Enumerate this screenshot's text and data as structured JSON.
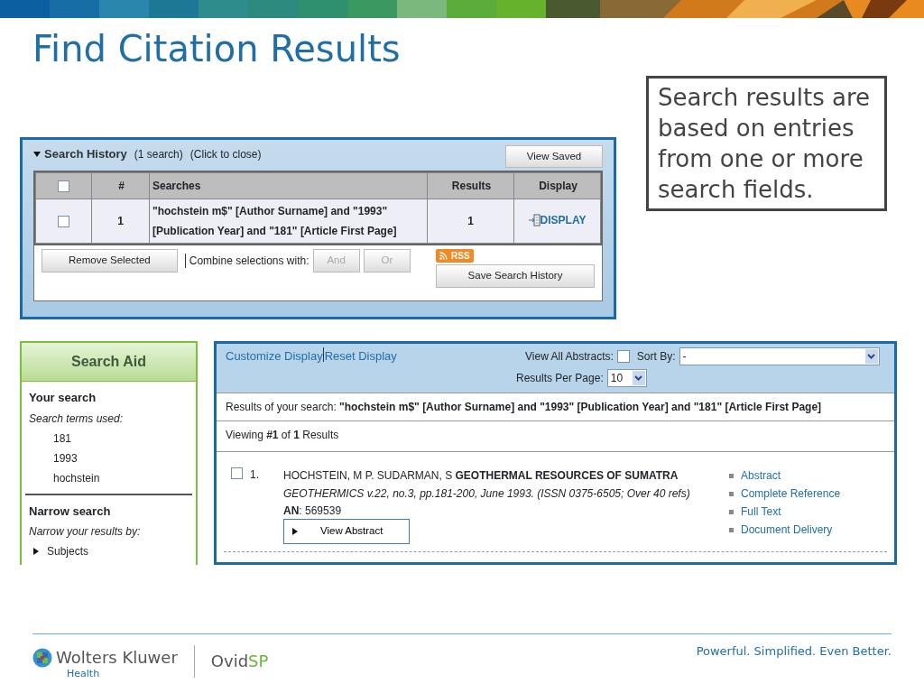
{
  "slide": {
    "title": "Find Citation Results",
    "callout": "Search results are based on entries from one or more search fields."
  },
  "search_history": {
    "title": "Search History",
    "count": "(1 search)",
    "hint": "(Click to close)",
    "expanded": true,
    "view_saved": "View Saved",
    "select_all": false,
    "columns": [
      "#",
      "Searches",
      "Results",
      "Display"
    ],
    "rows": [
      {
        "selected": false,
        "number": "1",
        "search": "\"hochstein m$\" [Author Surname] and \"1993\" [Publication Year] and \"181\" [Article First Page]",
        "results": "1",
        "display": "DISPLAY"
      }
    ],
    "remove_button": "Remove Selected",
    "combine_label": "Combine selections with:",
    "combine_buttons": [
      {
        "label": "And",
        "disabled": true
      },
      {
        "label": "Or",
        "disabled": true
      }
    ],
    "rss": "RSS",
    "save_button": "Save Search History"
  },
  "search_aid": {
    "title": "Search Aid",
    "your_search": "Your search",
    "terms_label": "Search terms used:",
    "terms": [
      "181",
      "1993",
      "hochstein"
    ],
    "narrow_heading": "Narrow search",
    "narrow_label": "Narrow your results by:",
    "facets": [
      {
        "label": "Subjects",
        "expanded": false
      }
    ]
  },
  "results": {
    "links": [
      "Customize Display",
      "Reset Display"
    ],
    "view_all_abstracts": {
      "label": "View All Abstracts:",
      "checked": false
    },
    "sort_by": {
      "label": "Sort By:",
      "value": "-"
    },
    "per_page": {
      "label": "Results Per Page:",
      "value": "10"
    },
    "summary": "Results of your search: **\"hochstein m$\" [Author Surname] and \"1993\" [Publication Year] and \"181\" [Article First Page]**",
    "viewing": "Viewing **#1** of **1** Results",
    "items": [
      {
        "number": "1.",
        "selected": false,
        "citation": "HOCHSTEIN, M P. SUDARMAN, S **GEOTHERMAL RESOURCES OF SUMATRA** *GEOTHERMICS v.22, no.3, pp.181-200, June 1993. (ISSN 0375-6505; Over 40 refs)*",
        "accession": "**AN**: 569539",
        "view_abstract": "View Abstract",
        "links": [
          "Abstract",
          "Complete Reference",
          "Full Text",
          "Document Delivery"
        ]
      }
    ]
  },
  "footer": {
    "brand": "Wolters Kluwer",
    "brand_sub": "Health",
    "product": "Ovid",
    "product_suffix": "SP",
    "tagline": "Powerful. Simplified. Even Better."
  }
}
